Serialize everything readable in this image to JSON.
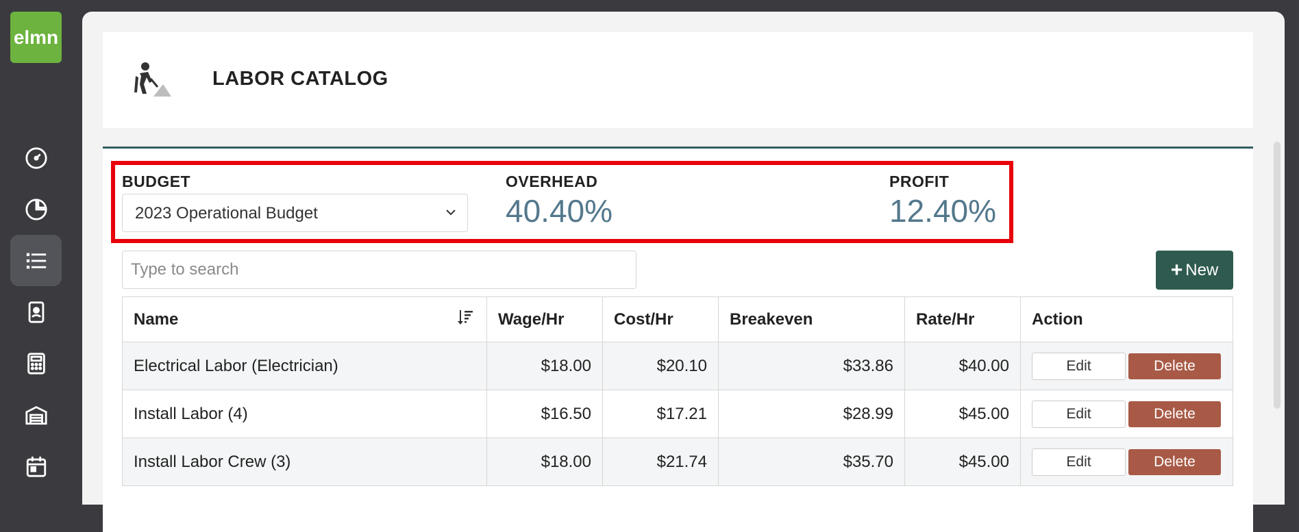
{
  "logo": {
    "text": "elmn",
    "color": "#6db33f"
  },
  "sidebar": {
    "items": [
      {
        "icon": "dashboard-gauge-icon"
      },
      {
        "icon": "pie-chart-icon"
      },
      {
        "icon": "list-icon",
        "active": true
      },
      {
        "icon": "contact-card-icon"
      },
      {
        "icon": "calculator-icon"
      },
      {
        "icon": "warehouse-icon"
      },
      {
        "icon": "calendar-icon"
      }
    ]
  },
  "header": {
    "title": "LABOR CATALOG",
    "icon": "worker-shovel-icon"
  },
  "stats": {
    "budget_label": "BUDGET",
    "budget_selected": "2023 Operational Budget",
    "overhead_label": "OVERHEAD",
    "overhead_value": "40.40%",
    "profit_label": "PROFIT",
    "profit_value": "12.40%"
  },
  "search": {
    "placeholder": "Type to search"
  },
  "new_button": {
    "label": "New"
  },
  "table": {
    "columns": [
      "Name",
      "Wage/Hr",
      "Cost/Hr",
      "Breakeven",
      "Rate/Hr",
      "Action"
    ],
    "rows": [
      {
        "name": "Electrical Labor (Electrician)",
        "wage": "$18.00",
        "cost": "$20.10",
        "breakeven": "$33.86",
        "rate": "$40.00"
      },
      {
        "name": "Install Labor (4)",
        "wage": "$16.50",
        "cost": "$17.21",
        "breakeven": "$28.99",
        "rate": "$45.00"
      },
      {
        "name": "Install Labor Crew (3)",
        "wage": "$18.00",
        "cost": "$21.74",
        "breakeven": "$35.70",
        "rate": "$45.00"
      }
    ],
    "edit_label": "Edit",
    "delete_label": "Delete"
  },
  "colors": {
    "accent": "#2f5a4f",
    "delete": "#a85a46",
    "stat_value": "#54788c",
    "highlight": "#e8000b"
  }
}
